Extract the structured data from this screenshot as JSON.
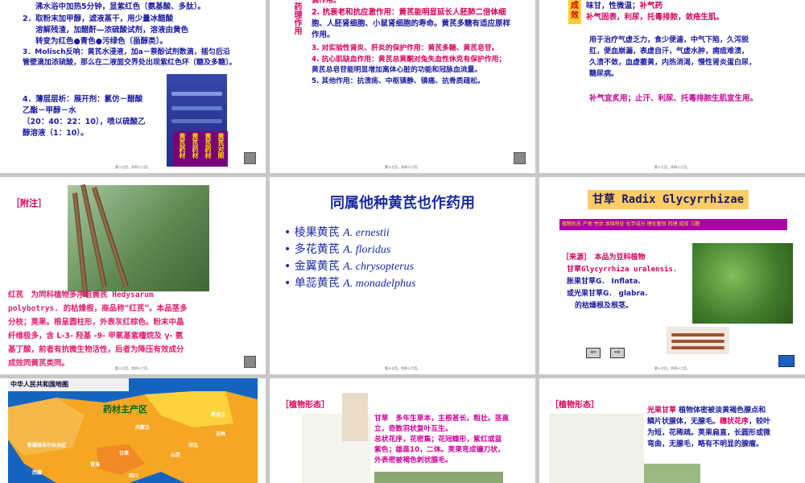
{
  "footer": "第十七页，共四十六页。",
  "s1": {
    "l0": "沸水浴中加热5分钟，显紫红色〔氨基酸、多肽〕。",
    "l1": "2．取粉末加甲醇，滤液蒸干，用少量冰醋酸",
    "l2": "溶解残渣，加醋酐—浓硫酸试剂，溶液由黄色",
    "l3": "转变为红色●青色●污绿色〔甾醇类〕。",
    "l4": "3．Molisch反响：黄芪水浸液，加a－萘酚试剂数滴，摇匀后沿",
    "l5": "管壁滴加浓硫酸，那么在二液面交界处出现紫红色环〔糖及多糖〕。",
    "l6": "4．薄层层析：展开剂：氯仿－醋酸",
    "l7": "乙酯－甲醇－水",
    "l8": "〔20：40：22：10〕，喷以硫酸乙",
    "l9": "醇溶液（1：10）。",
    "lanes": [
      "黄芪药材",
      "黄芪药材",
      "黄芪药材",
      "黄芪对照"
    ]
  },
  "s2": {
    "side": "药理作用",
    "l0": "调作用。",
    "l1": "2. 抗衰老和抗应激作用：黄芪能明显延长人胚肺二倍体细",
    "l2": "胞、人胚肾细胞、小鼠肾细胞的寿命。黄芪多糖有适应原样",
    "l3": "作用。",
    "l4": "3. 对实验性肾炎、肝炎的保护作用：黄芪多糖、黄芪皂苷。",
    "l5": "4. 抗心肌缺血作用：黄芪总黄酮对兔失血性休克有保护作用；",
    "l6": "黄芪总皂苷能明显增加离体心脏的功能和冠脉血流量。",
    "l7": "5. 其他作用：抗溃疡、中枢镇静、镇痛、抗骨质疏松。"
  },
  "s3": {
    "tag": "成效",
    "l1a": "味甘，性微温；",
    "l1b": "补气药",
    "l2": "补气固表，利尿，托毒排脓，敛疮生肌。",
    "l3": "用于治疗气虚乏力，食少便溏，中气下陷，久泻脱",
    "l4": "肛，便血崩漏，表虚自汗，气虚水肿，痈疽难溃，",
    "l5": "久溃不敛，血虚萎黄，内热消渴，慢性肾炎蛋白尿，",
    "l6": "糖尿病。",
    "l7": "补气宜炙用；止汗、利尿、托毒排脓生肌宜生用。"
  },
  "s4": {
    "tag": "［附注］",
    "l1": "红芪　为同科植物多序岩黄芪 Hedysarum",
    "l2": "polybotrys. 的枯燥根，商品称“红芪”。本品茎多",
    "l3": "分枝；荚果。根呈圆柱形，外表灰红棕色。粉末中晶",
    "l4": "纤维极多，含 L-3- 羟基 -9- 甲氧基紫檀烷及 γ- 氨",
    "l5": "基丁酸，前者有抗微生物活性，后者为降压有效成分",
    "l6": "成效同黄芪类同。"
  },
  "s5": {
    "title": "同属他种黄芪也作药用",
    "items": [
      {
        "cn": "棱果黄芪",
        "latin": "A. ernestii"
      },
      {
        "cn": "多花黄芪",
        "latin": "A. floridus"
      },
      {
        "cn": "金翼黄芪",
        "latin": "A. chrysopterus"
      },
      {
        "cn": "单蕊黄芪",
        "latin": "A. monadelphus"
      }
    ]
  },
  "s6": {
    "title": "甘草 Radix Glycyrrhizae",
    "bar": "植物形态 产地 性状 显微特征 化学成分 理化鉴别 药理 成效 习题",
    "l1": "［来源］　本品为豆科植物",
    "l2": "甘草Glycyrrhiza uralensis.",
    "l3": "胀果甘草G． Inflata.",
    "l4": "或光果甘草G． glabra.",
    "l5": "的枯燥根及根茎。",
    "prev": "⇦",
    "next": "⇨"
  },
  "s7": {
    "banner": "中华人民共和国地图",
    "label": "药材主产区",
    "provinces": [
      "新疆维吾尔自治区",
      "西藏",
      "青海",
      "甘肃",
      "内蒙古",
      "黑龙江",
      "吉林",
      "四川",
      "山西",
      "河北"
    ]
  },
  "s8": {
    "tag": "［植物形态］",
    "l1": "甘草　多年生草本，主根甚长，粗壮。茎直",
    "l2": "立，奇数羽状复叶互生。",
    "l3": "总状花序，花密集；花冠蝶形，紫红或蓝",
    "l4": "紫色；雄蕊10，二体。荚果弯成镰刀状，",
    "l5": "外表密被褐色刺状腺毛。"
  },
  "s9": {
    "tag": "［植物形态］",
    "l1a": "光果甘草",
    "l1b": " 植物体密被淡黄褐色腺点和",
    "l2": "鳞片状腺体，无腺毛。",
    "l2b": "穗状花序",
    "l2c": "，较叶",
    "l3": "为短，花稀疏。荚果扁直，长圆形或微",
    "l4": "弯曲，无腺毛，略有不明显的腺瘤。"
  }
}
